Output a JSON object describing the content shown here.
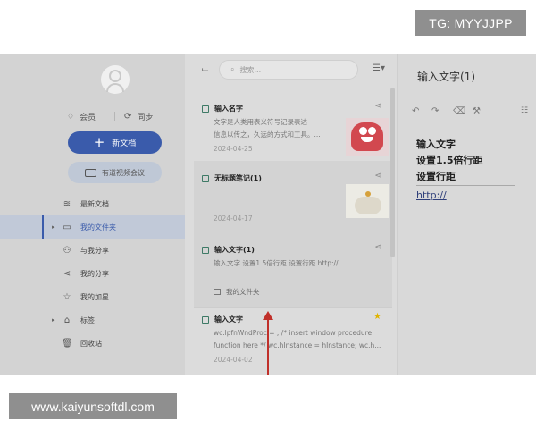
{
  "watermark": {
    "tg": "TG: MYYJJPP",
    "url": "www.kaiyunsoftdl.com"
  },
  "sidebar": {
    "account": {
      "vip_label": "会员",
      "sync_label": "同步"
    },
    "new_doc_label": "新文档",
    "video_meeting_label": "有道视频会议",
    "items": [
      {
        "label": "最新文档",
        "icon": "layers-icon"
      },
      {
        "label": "我的文件夹",
        "icon": "folder-icon",
        "active": true
      },
      {
        "label": "与我分享",
        "icon": "users-icon"
      },
      {
        "label": "我的分享",
        "icon": "share-icon"
      },
      {
        "label": "我的加星",
        "icon": "star-icon"
      },
      {
        "label": "标签",
        "icon": "tag-icon"
      },
      {
        "label": "回收站",
        "icon": "trash-icon"
      }
    ]
  },
  "list": {
    "search_placeholder": "搜索...",
    "cards": [
      {
        "title": "输入名字",
        "snippet1": "文字是人类用表义符号记录表达",
        "snippet2": "信息以传之，久远的方式和工具。...",
        "date": "2024-04-25"
      },
      {
        "title": "无标题笔记(1)",
        "date": "2024-04-17"
      },
      {
        "title": "输入文字(1)",
        "snippet1": "输入文字 设置1.5倍行距 设置行距 http://",
        "folder": "我的文件夹"
      },
      {
        "title": "输入文字",
        "snippet1": "wc.lpfnWndProc = ; /* insert window procedure",
        "snippet2": "function here */ wc.hInstance = hInstance; wc.h...",
        "date": "2024-04-02"
      }
    ]
  },
  "editor": {
    "title": "输入文字(1)",
    "lines": [
      "输入文字",
      "设置1.5倍行距",
      "设置行距"
    ],
    "link": "http://"
  },
  "colors": {
    "accent": "#3a5bab",
    "arrow": "#c0302a",
    "star": "#e0b400"
  }
}
